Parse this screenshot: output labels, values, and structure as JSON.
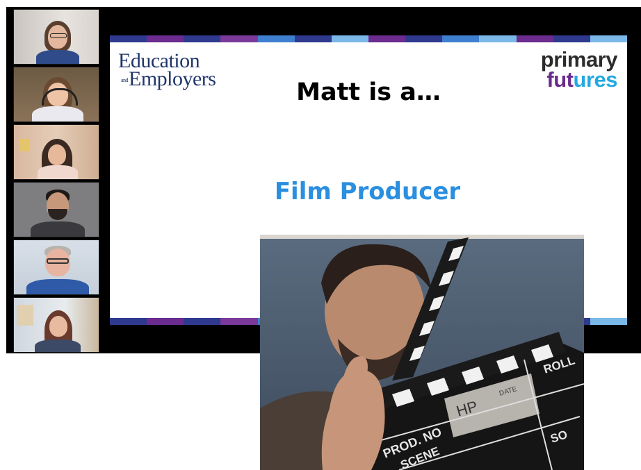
{
  "slide": {
    "logo_left_line1": "Education",
    "logo_left_and": "and",
    "logo_left_line2": "Employers",
    "logo_right_line1": "primary",
    "logo_right_line2_part1": "fut",
    "logo_right_line2_part2": "ures",
    "title": "Matt is a…",
    "answer": "Film Producer",
    "stripe_colors": [
      "#2f3a8f",
      "#6b2b8f",
      "#2f3a8f",
      "#7b3a9a",
      "#3f7fd0",
      "#2f3a8f",
      "#7ab8e8",
      "#6b2b8f",
      "#2f3a8f",
      "#3f7fd0",
      "#7ab8e8",
      "#6b2b8f",
      "#2f3a8f",
      "#7ab8e8"
    ]
  },
  "inset_video": {
    "clapper_text": {
      "initials": "HP",
      "date": "DATE",
      "prod": "PROD. NO",
      "scene": "SCENE",
      "roll": "ROLL",
      "sound": "SO"
    }
  },
  "participants": [
    {
      "icon": "person-woman-glasses"
    },
    {
      "icon": "person-woman-headset"
    },
    {
      "icon": "person-woman-dark-hair"
    },
    {
      "icon": "person-man-beard"
    },
    {
      "icon": "person-man-glasses"
    },
    {
      "icon": "person-woman-office"
    }
  ]
}
